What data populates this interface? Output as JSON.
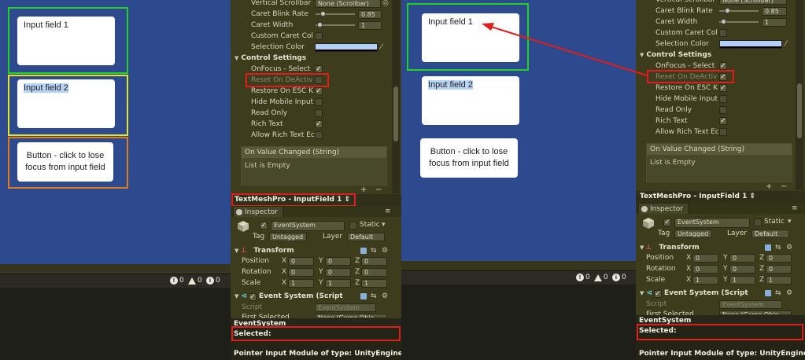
{
  "left_game": {
    "input1": "Input field 1",
    "input2": "Input field 2",
    "button": "Button - click to lose focus from input field"
  },
  "right_game": {
    "input1": "Input field 1",
    "input2": "Input field 2",
    "button": "Button - click to lose focus from input field"
  },
  "status": {
    "errors": "0",
    "warnings": "0",
    "messages": "0"
  },
  "inspector": {
    "rows": {
      "vertical_scrollbar": "Vertical Scrollbar",
      "vertical_scrollbar_value": "None (Scrollbar)",
      "caret_blink_rate": "Caret Blink Rate",
      "caret_blink_rate_value": "0.85",
      "caret_width": "Caret Width",
      "caret_width_value": "1",
      "custom_caret_color": "Custom Caret Col",
      "selection_color": "Selection Color",
      "control_settings": "Control Settings",
      "onfocus_select": "OnFocus - Select",
      "reset_on_deactivation": "Reset On DeActiv",
      "restore_on_esc": "Restore On ESC K",
      "hide_mobile_input": "Hide Mobile Input",
      "read_only": "Read Only",
      "rich_text": "Rich Text",
      "allow_rich_text": "Allow Rich Text Ec"
    },
    "event": {
      "header": "On Value Changed (String)",
      "body": "List is Empty"
    },
    "title_bar": "TextMeshPro - InputField 1",
    "tab": "Inspector",
    "object": {
      "name": "EventSystem",
      "static": "Static",
      "tag_label": "Tag",
      "tag_value": "Untagged",
      "layer_label": "Layer",
      "layer_value": "Default"
    },
    "transform": {
      "title": "Transform",
      "position": "Position",
      "rotation": "Rotation",
      "scale": "Scale",
      "x": "X",
      "y": "Y",
      "z": "Z",
      "pos": [
        "0",
        "0",
        "0"
      ],
      "rot": [
        "0",
        "0",
        "0"
      ],
      "scl": [
        "1",
        "1",
        "1"
      ]
    },
    "event_system": {
      "title": "Event System (Script",
      "script_label": "Script",
      "script_value": "EventSystem",
      "first_selected": "First Selected",
      "first_selected_value": "None (Game Obje"
    },
    "preview": {
      "header": "EventSystem",
      "selected": "Selected:",
      "pointer": "Pointer Input Module of type: UnityEngine"
    }
  },
  "colors": {
    "game_bg": "#2e4a8e",
    "frame_green": "#22d122",
    "frame_yellow": "#e6e61e",
    "frame_orange": "#e07a1e",
    "highlight_red": "#e01c1c",
    "selection_blue": "#b4cff6"
  }
}
